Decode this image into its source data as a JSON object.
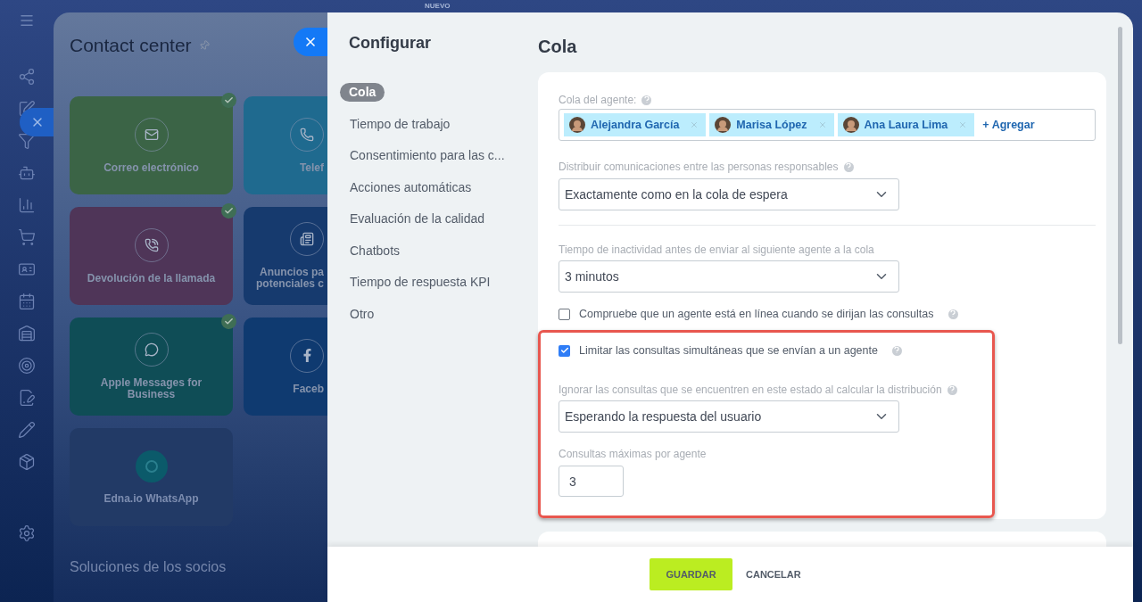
{
  "top_label": "NUEVO",
  "contact_center": {
    "title": "Contact center",
    "tiles": [
      {
        "lines": [
          "Correo electrónico"
        ],
        "kind": "mail",
        "color": "#3b6446",
        "connected": true
      },
      {
        "lines": [
          "Telef"
        ],
        "kind": "phone",
        "color": "#1f6a8f",
        "connected": false
      },
      {
        "lines": [
          "Devolución de la llamada"
        ],
        "kind": "callback",
        "color": "#4f3558",
        "connected": true
      },
      {
        "lines": [
          "Anuncios pa",
          "potenciales c"
        ],
        "kind": "ads",
        "color": "#163a6e",
        "connected": false
      },
      {
        "lines": [
          "Apple Messages for",
          "Business"
        ],
        "kind": "chat",
        "color": "#0f4d56",
        "connected": true
      },
      {
        "lines": [
          "Faceb"
        ],
        "kind": "facebook",
        "color": "#0f3a70",
        "connected": false
      },
      {
        "lines": [
          "Edna.io WhatsApp"
        ],
        "kind": "edna",
        "color": "#223a66",
        "connected": false
      }
    ],
    "partners_heading": "Soluciones de los socios"
  },
  "settings": {
    "title": "Configurar",
    "nav": [
      {
        "label": "Cola",
        "selected": true
      },
      {
        "label": "Tiempo de trabajo",
        "selected": false
      },
      {
        "label": "Consentimiento para las c...",
        "selected": false
      },
      {
        "label": "Acciones automáticas",
        "selected": false
      },
      {
        "label": "Evaluación de la calidad",
        "selected": false
      },
      {
        "label": "Chatbots",
        "selected": false
      },
      {
        "label": "Tiempo de respuesta KPI",
        "selected": false
      },
      {
        "label": "Otro",
        "selected": false
      }
    ],
    "page_title": "Cola",
    "agent_queue": {
      "label": "Cola del agente:",
      "agents": [
        "Alejandra García",
        "Marisa López",
        "Ana Laura Lima"
      ],
      "add_link": "+ Agregar"
    },
    "distribution": {
      "label": "Distribuir comunicaciones entre las personas responsables",
      "value": "Exactamente como en la cola de espera"
    },
    "inactivity": {
      "label": "Tiempo de inactividad antes de enviar al siguiente agente a la cola",
      "value": "3 minutos"
    },
    "online_check": {
      "label": "Compruebe que un agente está en línea cuando se dirijan las consultas",
      "checked": false
    },
    "limit": {
      "label": "Limitar las consultas simultáneas que se envían a un agente",
      "checked": true
    },
    "ignore": {
      "label": "Ignorar las consultas que se encuentren en este estado al calcular la distribución",
      "value": "Esperando la respuesta del usuario"
    },
    "max": {
      "label": "Consultas máximas por agente",
      "value": "3"
    }
  },
  "footer": {
    "save": "GUARDAR",
    "cancel": "CANCELAR"
  }
}
